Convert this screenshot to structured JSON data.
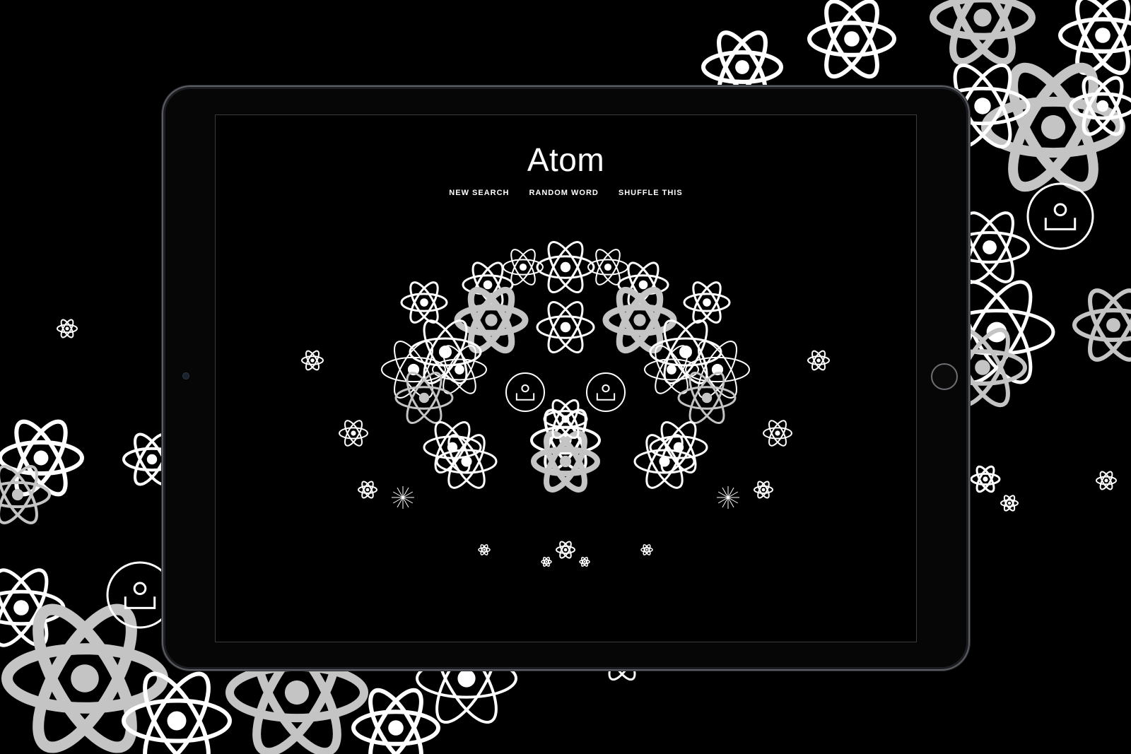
{
  "app": {
    "title": "Atom"
  },
  "nav": [
    {
      "label": "NEW SEARCH"
    },
    {
      "label": "RANDOM WORD"
    },
    {
      "label": "SHUFFLE THIS"
    }
  ],
  "colors": {
    "background": "#000000",
    "foreground": "#ffffff",
    "secondary": "#bdbdbd"
  },
  "pattern_icons": [
    "atom-icon",
    "camera-icon",
    "spark-icon"
  ]
}
